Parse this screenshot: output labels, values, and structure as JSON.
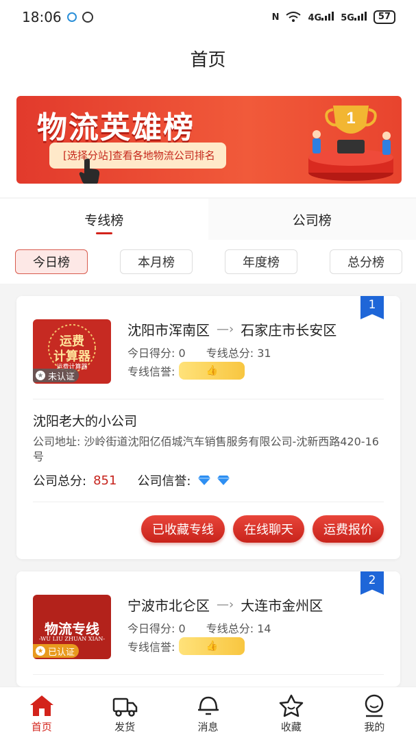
{
  "status": {
    "time": "18:06",
    "battery": "57",
    "network_4g": "4G",
    "network_5g": "5G"
  },
  "header": {
    "title": "首页"
  },
  "banner": {
    "title": "物流英雄榜",
    "subtitle": "[选择分站]查看各地物流公司排名",
    "trophy_number": "1"
  },
  "tabs": [
    {
      "label": "专线榜",
      "active": true
    },
    {
      "label": "公司榜",
      "active": false
    }
  ],
  "filters": [
    {
      "label": "今日榜",
      "active": true
    },
    {
      "label": "本月榜"
    },
    {
      "label": "年度榜"
    },
    {
      "label": "总分榜"
    }
  ],
  "cards": [
    {
      "rank": "1",
      "thumb_line1": "运费",
      "thumb_line2": "计算器",
      "thumb_caption": "运费计算器",
      "badge": "未认证",
      "from": "沈阳市浑南区",
      "to": "石家庄市长安区",
      "today_label": "今日得分:",
      "today_score": "0",
      "total_label": "专线总分:",
      "total_score": "31",
      "credit_label": "专线信誉:",
      "company": "沈阳老大的小公司",
      "address": "公司地址:  沙岭街道沈阳亿佰城汽车销售服务有限公司-沈新西路420-16号",
      "company_total_label": "公司总分:",
      "company_total": "851",
      "company_credit_label": "公司信誉:",
      "actions": [
        "已收藏专线",
        "在线聊天",
        "运费报价"
      ]
    },
    {
      "rank": "2",
      "thumb_line1": "物流专线",
      "thumb_caption": "-WU LIU ZHUAN XIAN-",
      "badge": "已认证",
      "from": "宁波市北仑区",
      "to": "大连市金州区",
      "today_label": "今日得分:",
      "today_score": "0",
      "total_label": "专线总分:",
      "total_score": "14",
      "credit_label": "专线信誉:"
    }
  ],
  "tabbar": [
    {
      "label": "首页",
      "icon": "home-icon",
      "active": true
    },
    {
      "label": "发货",
      "icon": "truck-icon"
    },
    {
      "label": "消息",
      "icon": "message-icon"
    },
    {
      "label": "收藏",
      "icon": "star-icon"
    },
    {
      "label": "我的",
      "icon": "user-icon"
    }
  ],
  "colors": {
    "accent": "#d3231b",
    "rank_blue": "#1e66d8"
  }
}
